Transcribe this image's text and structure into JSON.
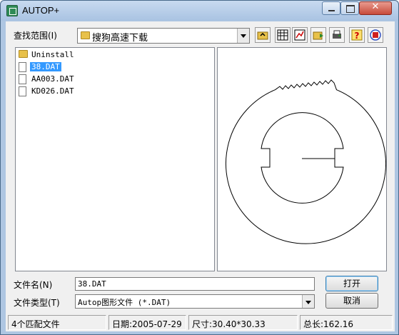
{
  "window": {
    "title": "AUTOP+"
  },
  "lookin": {
    "label": "查找范围(I)",
    "value": "搜狗高速下载"
  },
  "toolbar": {
    "icons": [
      "folder-up-icon",
      "grid-view-icon",
      "graph-icon",
      "folder-open-icon",
      "print-icon",
      "help-icon",
      "note-icon"
    ]
  },
  "files": [
    {
      "name": "Uninstall",
      "type": "folder"
    },
    {
      "name": "38.DAT",
      "type": "file",
      "selected": true
    },
    {
      "name": "AA003.DAT",
      "type": "file"
    },
    {
      "name": "KD026.DAT",
      "type": "file"
    }
  ],
  "filename": {
    "label": "文件名(N)",
    "value": "38.DAT"
  },
  "filetype": {
    "label": "文件类型(T)",
    "value": "Autop图形文件 (*.DAT)"
  },
  "buttons": {
    "open": "打开",
    "cancel": "取消"
  },
  "status": {
    "count": "4个匹配文件",
    "date": "日期:2005-07-29",
    "size": "尺寸:30.40*30.33",
    "length": "总长:162.16"
  }
}
